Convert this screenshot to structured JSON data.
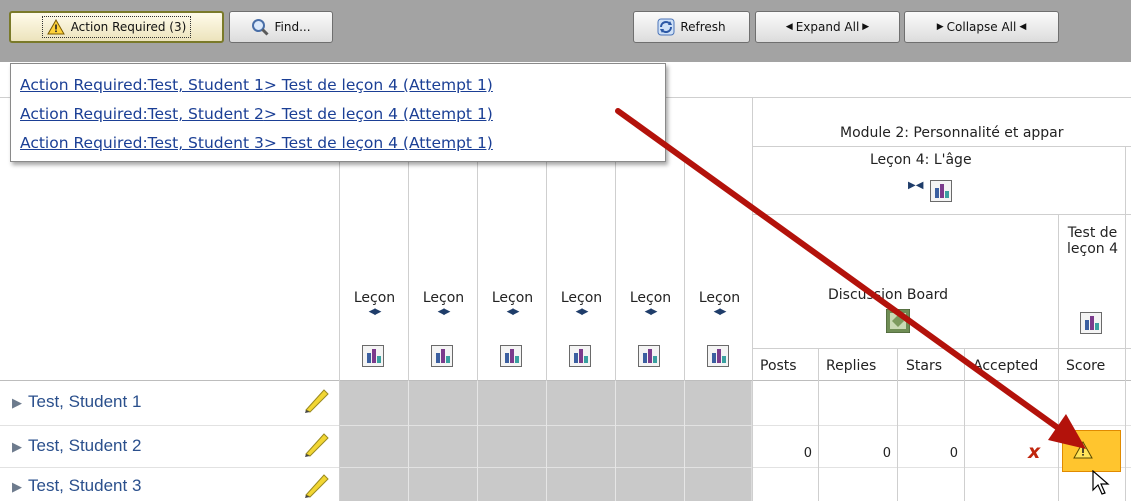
{
  "toolbar": {
    "action_required_label": "Action Required (3)",
    "find_label": "Find...",
    "refresh_label": "Refresh",
    "expand_all_label": "Expand All",
    "collapse_all_label": "Collapse All"
  },
  "action_dropdown": {
    "items": [
      {
        "prefix": "Action Required:Test, Student 1",
        "suffix": "> Test de leçon 4 (Attempt 1)"
      },
      {
        "prefix": "Action Required:Test, Student 2",
        "suffix": "> Test de leçon 4 (Attempt 1)"
      },
      {
        "prefix": "Action Required:Test, Student 3",
        "suffix": "> Test de leçon 4 (Attempt 1)"
      }
    ]
  },
  "grid": {
    "module_header": "Module 2: Personnalité et appar",
    "lesson_header": "Leçon 4: L'âge",
    "lecon_columns": [
      "Leçon",
      "Leçon",
      "Leçon",
      "Leçon",
      "Leçon",
      "Leçon"
    ],
    "discussion_board_label": "Discussion Board",
    "test_label": "Test de leçon 4",
    "subheaders": [
      "Posts",
      "Replies",
      "Stars",
      "Accepted",
      "Score"
    ]
  },
  "students": [
    {
      "name": "Test, Student 1",
      "posts": "",
      "replies": "",
      "stars": "",
      "accepted": "",
      "score": ""
    },
    {
      "name": "Test, Student 2",
      "posts": "0",
      "replies": "0",
      "stars": "0",
      "accepted": "x",
      "score": "needs-grading-warning-icon"
    },
    {
      "name": "Test, Student 3",
      "posts": "",
      "replies": "",
      "stars": "",
      "accepted": "",
      "score": ""
    }
  ],
  "colors": {
    "toolbar_bg": "#a3a3a3",
    "link": "#1b3f95",
    "student_link": "#2a4f8c",
    "gray_cell": "#c9c9c9",
    "warning_cell": "#ffc52e",
    "arrow": "#b3120b",
    "accepted_x": "#c0260e"
  }
}
